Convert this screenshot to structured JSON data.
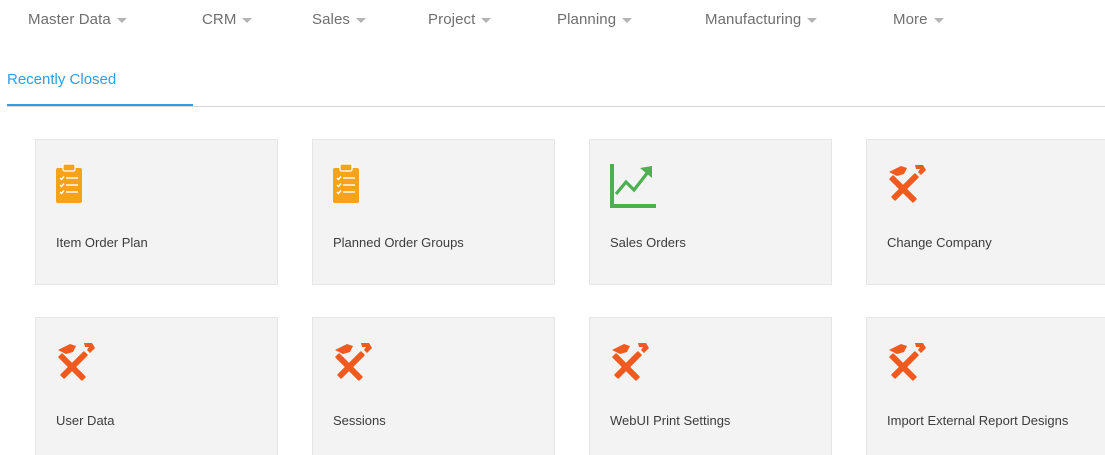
{
  "menu": {
    "items": [
      {
        "label": "Master Data"
      },
      {
        "label": "CRM"
      },
      {
        "label": "Sales"
      },
      {
        "label": "Project"
      },
      {
        "label": "Planning"
      },
      {
        "label": "Manufacturing"
      },
      {
        "label": "More"
      }
    ]
  },
  "tabs": [
    {
      "label": "Recently Closed",
      "active": true
    }
  ],
  "colors": {
    "accent": "#2e9ee6",
    "clipboard_icon": "#f6a31a",
    "chart_icon": "#4caf50",
    "tools_icon": "#f05a1f",
    "tile_bg": "#f3f3f3"
  },
  "tiles": [
    {
      "label": "Item Order Plan",
      "icon": "clipboard-icon"
    },
    {
      "label": "Planned Order Groups",
      "icon": "clipboard-icon"
    },
    {
      "label": "Sales Orders",
      "icon": "trend-chart-icon"
    },
    {
      "label": "Change Company",
      "icon": "tools-icon"
    },
    {
      "label": "User Data",
      "icon": "tools-icon"
    },
    {
      "label": "Sessions",
      "icon": "tools-icon"
    },
    {
      "label": "WebUI Print Settings",
      "icon": "tools-icon"
    },
    {
      "label": "Import External Report Designs",
      "icon": "tools-icon"
    }
  ]
}
